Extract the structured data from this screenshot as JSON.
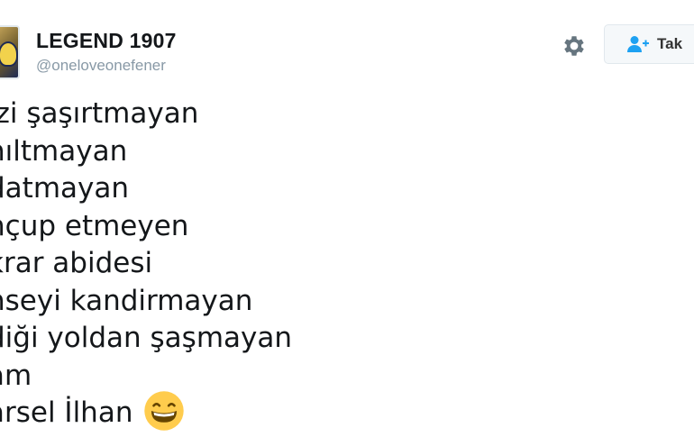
{
  "user": {
    "display_name": "LEGEND 1907",
    "handle": "@oneloveonefener"
  },
  "actions": {
    "settings_icon": "gear-icon",
    "follow_icon": "add-user-icon",
    "follow_label": "Tak"
  },
  "tweet": {
    "lines": [
      "izi şaşırtmayan",
      "nıltmayan",
      "datmayan",
      "hçup etmeyen",
      "krar abidesi",
      "nseyi kandirmayan",
      "diği yoldan şaşmayan",
      "am",
      "arsel İlhan"
    ],
    "emoji": "grinning-face-emoji"
  },
  "colors": {
    "handle": "#8899a6",
    "accent": "#1da1f2",
    "text": "#14171a"
  }
}
